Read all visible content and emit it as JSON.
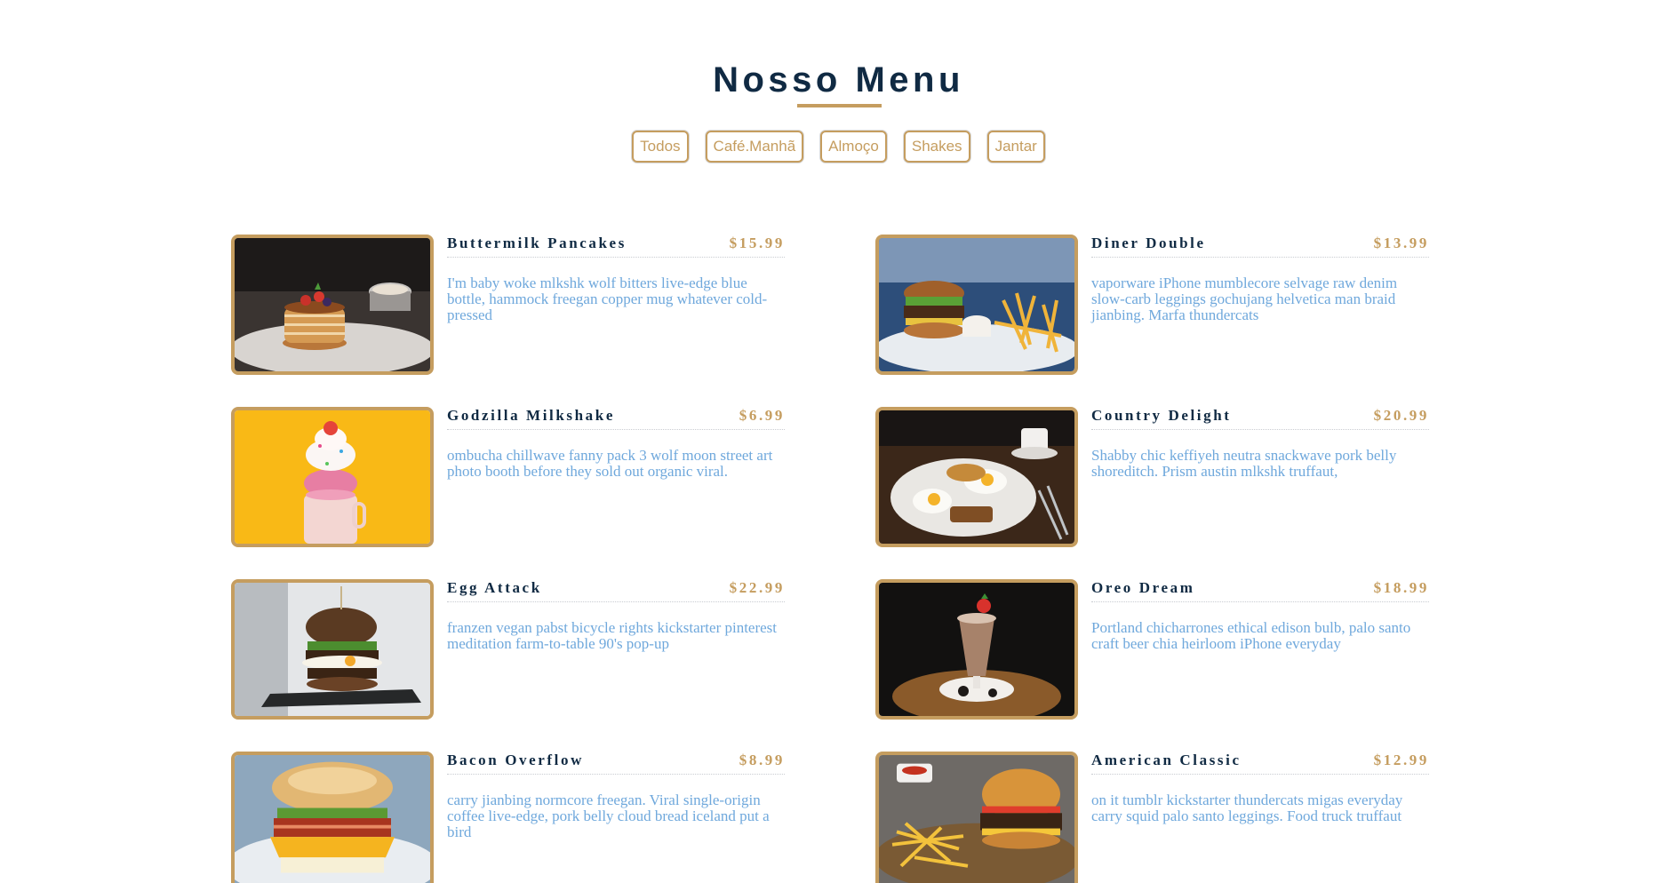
{
  "page": {
    "title": "Nosso Menu",
    "accent_color": "#c59d5f",
    "title_color": "#102a43",
    "desc_color": "#6fa8dc"
  },
  "filters": [
    "Todos",
    "Café.Manhã",
    "Almoço",
    "Shakes",
    "Jantar"
  ],
  "menu": [
    {
      "name": "Buttermilk Pancakes",
      "price": "$15.99",
      "desc": "I'm baby woke mlkshk wolf bitters live-edge blue bottle, hammock freegan copper mug whatever cold-pressed",
      "image": "pancakes-photo"
    },
    {
      "name": "Diner Double",
      "price": "$13.99",
      "desc": "vaporware iPhone mumblecore selvage raw denim slow-carb leggings gochujang helvetica man braid jianbing. Marfa thundercats",
      "image": "burger-fries-photo"
    },
    {
      "name": "Godzilla Milkshake",
      "price": "$6.99",
      "desc": "ombucha chillwave fanny pack 3 wolf moon street art photo booth before they sold out organic viral.",
      "image": "milkshake-photo"
    },
    {
      "name": "Country Delight",
      "price": "$20.99",
      "desc": "Shabby chic keffiyeh neutra snackwave pork belly shoreditch. Prism austin mlkshk truffaut,",
      "image": "breakfast-plate-photo"
    },
    {
      "name": "Egg Attack",
      "price": "$22.99",
      "desc": "franzen vegan pabst bicycle rights kickstarter pinterest meditation farm-to-table 90's pop-up",
      "image": "egg-burger-photo"
    },
    {
      "name": "Oreo Dream",
      "price": "$18.99",
      "desc": "Portland chicharrones ethical edison bulb, palo santo craft beer chia heirloom iPhone everyday",
      "image": "oreo-shake-photo"
    },
    {
      "name": "Bacon Overflow",
      "price": "$8.99",
      "desc": "carry jianbing normcore freegan. Viral single-origin coffee live-edge, pork belly cloud bread iceland put a bird",
      "image": "bacon-sandwich-photo"
    },
    {
      "name": "American Classic",
      "price": "$12.99",
      "desc": "on it tumblr kickstarter thundercats migas everyday carry squid palo santo leggings. Food truck truffaut",
      "image": "classic-burger-photo"
    }
  ]
}
